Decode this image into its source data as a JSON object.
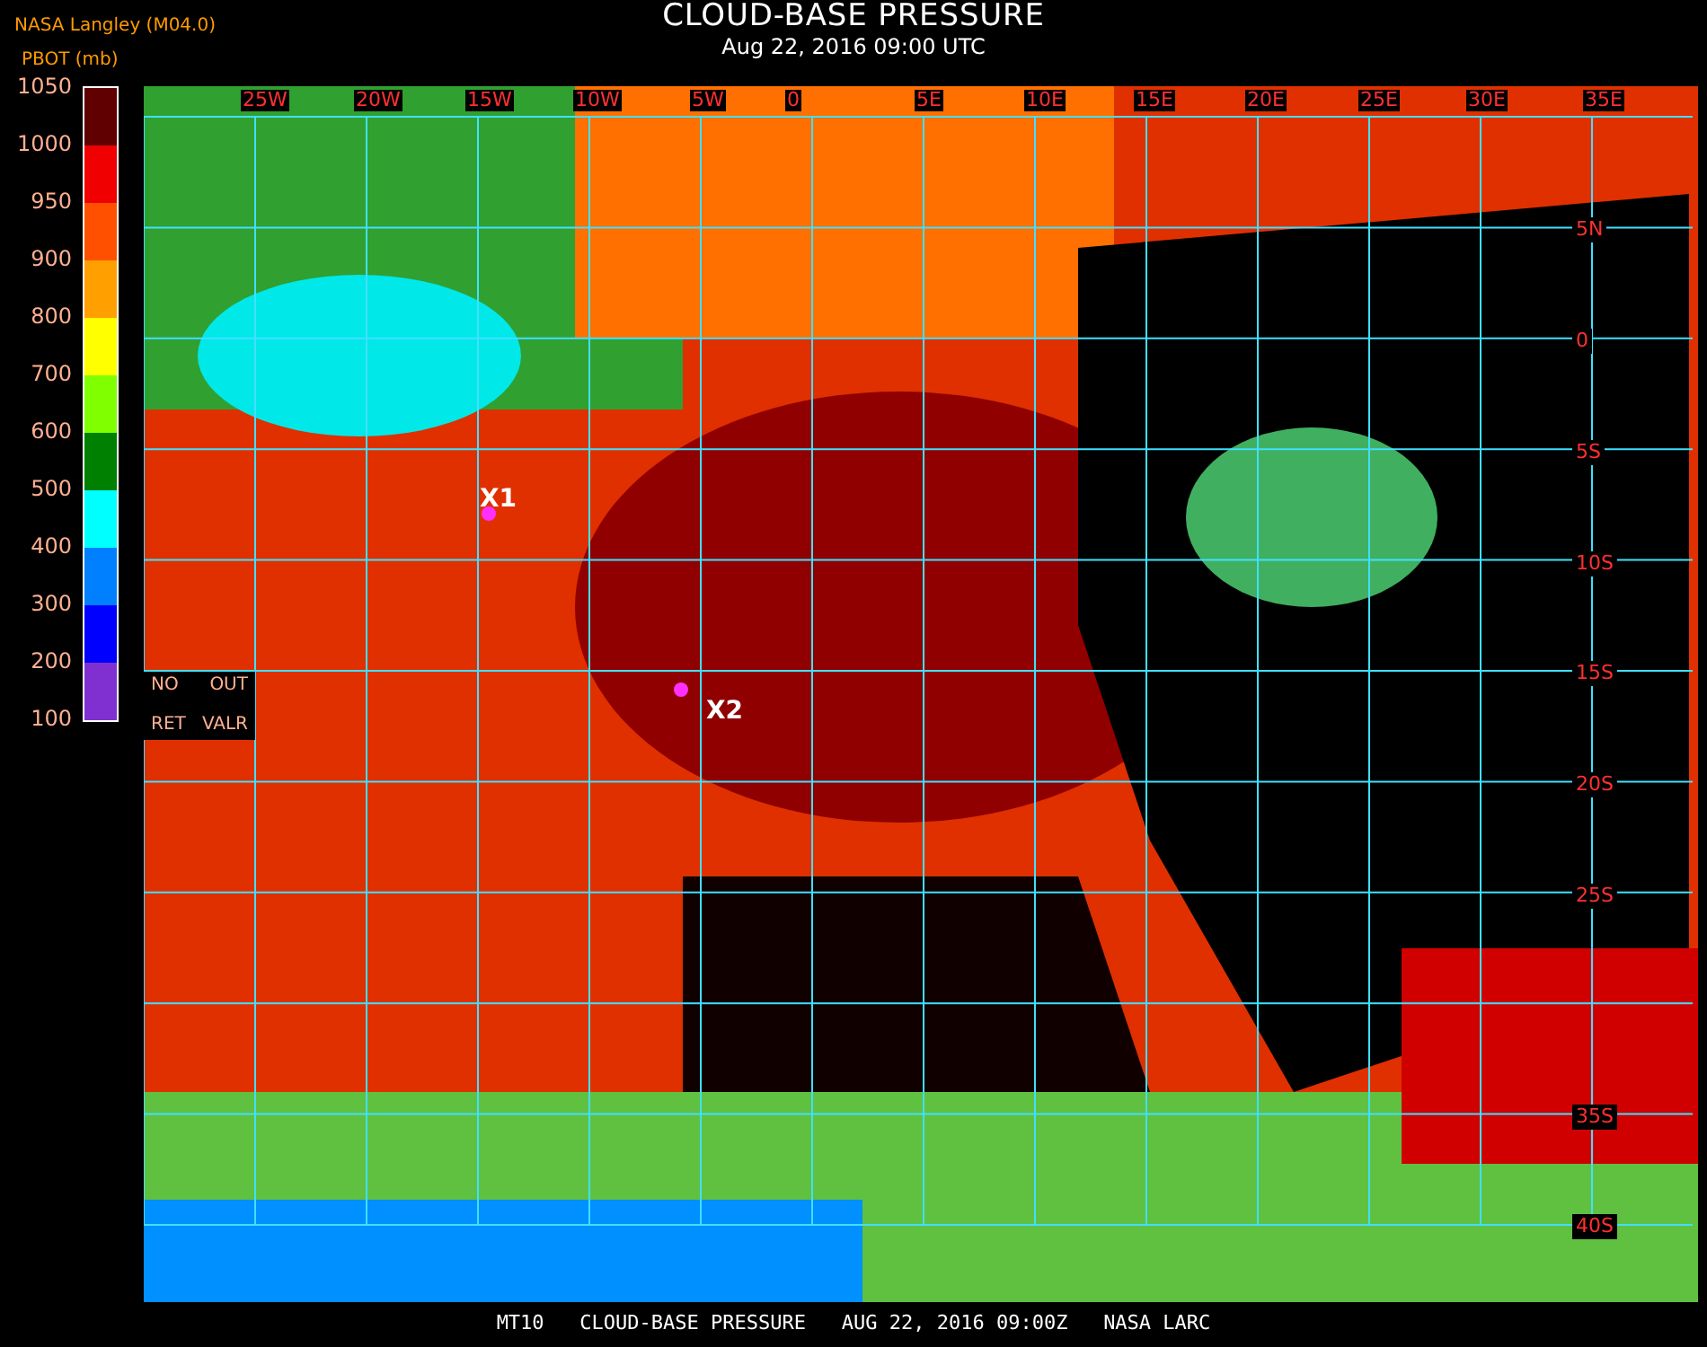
{
  "header": {
    "source": "NASA Langley (M04.0)",
    "title": "CLOUD-BASE PRESSURE",
    "subtitle": "Aug 22, 2016 09:00 UTC"
  },
  "legend": {
    "title": "PBOT (mb)",
    "labels": [
      "1050",
      "1000",
      "950",
      "900",
      "800",
      "700",
      "600",
      "500",
      "400",
      "300",
      "200",
      "100"
    ],
    "bins": [
      {
        "color": "#600000"
      },
      {
        "color": "#f00000"
      },
      {
        "color": "#ff5000"
      },
      {
        "color": "#ffa000"
      },
      {
        "color": "#ffff00"
      },
      {
        "color": "#80ff00"
      },
      {
        "color": "#008000"
      },
      {
        "color": "#00ffff"
      },
      {
        "color": "#0080ff"
      },
      {
        "color": "#0000ff"
      },
      {
        "color": "#8030d0"
      }
    ]
  },
  "map": {
    "lon_labels": [
      "25W",
      "20W",
      "15W",
      "10W",
      "5W",
      "0",
      "5E",
      "10E",
      "15E",
      "20E",
      "25E",
      "30E",
      "35E"
    ],
    "lat_labels": [
      "5N",
      "0",
      "5S",
      "10S",
      "15S",
      "20S",
      "25S",
      "35S",
      "40S"
    ],
    "no_retrieval": {
      "line_1": [
        "NO",
        "OUT"
      ],
      "line_2": [
        "RET",
        "VALR"
      ]
    },
    "markers": [
      {
        "label": "X1"
      },
      {
        "label": "X2"
      }
    ]
  },
  "footer": "MT10   CLOUD-BASE PRESSURE   AUG 22, 2016 09:00Z   NASA LARC"
}
